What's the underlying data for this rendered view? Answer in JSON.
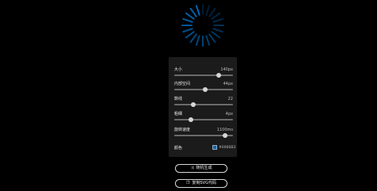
{
  "spinner": {
    "segments": 20,
    "color": "#0066b3"
  },
  "controls": [
    {
      "id": "size",
      "label": "大小",
      "value": "140px",
      "fraction": 0.75
    },
    {
      "id": "inner",
      "label": "内部空间",
      "value": "44px",
      "fraction": 0.53
    },
    {
      "id": "count",
      "label": "数线",
      "value": "22",
      "fraction": 0.33
    },
    {
      "id": "stroke",
      "label": "粗细",
      "value": "4px",
      "fraction": 0.29
    },
    {
      "id": "speed",
      "label": "旋转速度",
      "value": "1100ms",
      "fraction": 0.87
    }
  ],
  "color": {
    "label": "颜色",
    "value": "#0066B3",
    "swatch": "#0066b3"
  },
  "buttons": {
    "random": {
      "label": "随机生成",
      "icon": "shuffle-icon",
      "glyph": "⤨"
    },
    "copy": {
      "label": "复制SVG代码",
      "icon": "copy-icon",
      "glyph": "❐"
    }
  }
}
